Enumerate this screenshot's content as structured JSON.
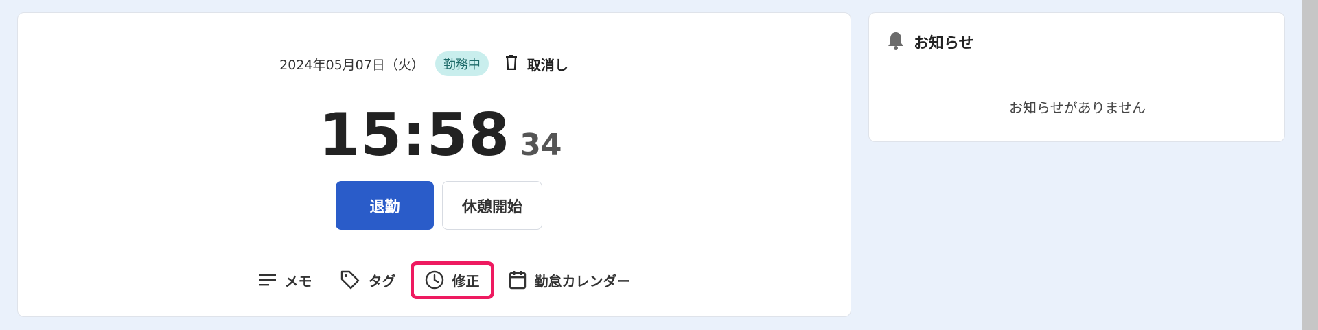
{
  "attendance": {
    "date": "2024年05月07日（火）",
    "status_badge": "勤務中",
    "cancel_label": "取消し",
    "clock_hm": "15:58",
    "clock_seconds": "34",
    "primary_button": "退勤",
    "secondary_button": "休憩開始",
    "actions": {
      "memo": "メモ",
      "tag": "タグ",
      "edit": "修正",
      "calendar": "勤怠カレンダー"
    }
  },
  "notice": {
    "title": "お知らせ",
    "empty_message": "お知らせがありません"
  },
  "colors": {
    "background": "#eaf1fb",
    "primary": "#2a5cc9",
    "badge_bg": "#c9eeed",
    "highlight": "#ee1a60"
  },
  "icons": [
    "trash-icon",
    "memo-lines-icon",
    "tag-icon",
    "clock-icon",
    "calendar-icon",
    "bell-icon"
  ]
}
